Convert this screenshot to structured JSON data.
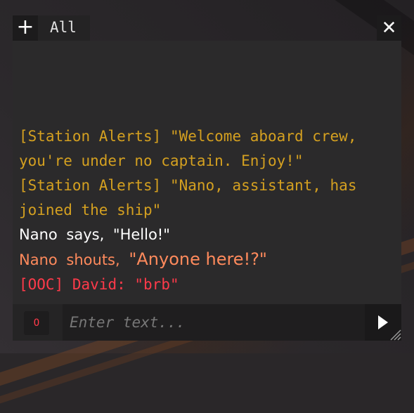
{
  "toolbar": {
    "add_label": "+",
    "tab_label": "All",
    "close_label": "✕"
  },
  "messages": [
    {
      "type": "alert",
      "source": "[Station Alerts]",
      "text": "\"Welcome aboard crew, you're under no captain. Enjoy!\"",
      "color": "#d4a020"
    },
    {
      "type": "alert",
      "source": "[Station Alerts]",
      "text": "\"Nano, assistant, has joined the ship\"",
      "color": "#d4a020"
    },
    {
      "type": "say",
      "speaker": "Nano",
      "verb": "says,",
      "text": "\"Hello!\"",
      "color": "#ffffff"
    },
    {
      "type": "shout",
      "speaker": "Nano",
      "verb": "shouts,",
      "text": "\"Anyone here!?\"",
      "color": "#ff8a5c"
    },
    {
      "type": "ooc",
      "tag": "[OOC]",
      "speaker": "David:",
      "text": "\"brb\"",
      "color": "#ff3a4a"
    }
  ],
  "input": {
    "badge": "O",
    "placeholder": "Enter text...",
    "value": ""
  },
  "icons": {
    "add": "plus-icon",
    "close": "close-icon",
    "send": "play-arrow-icon",
    "resize": "resize-grip-icon"
  }
}
